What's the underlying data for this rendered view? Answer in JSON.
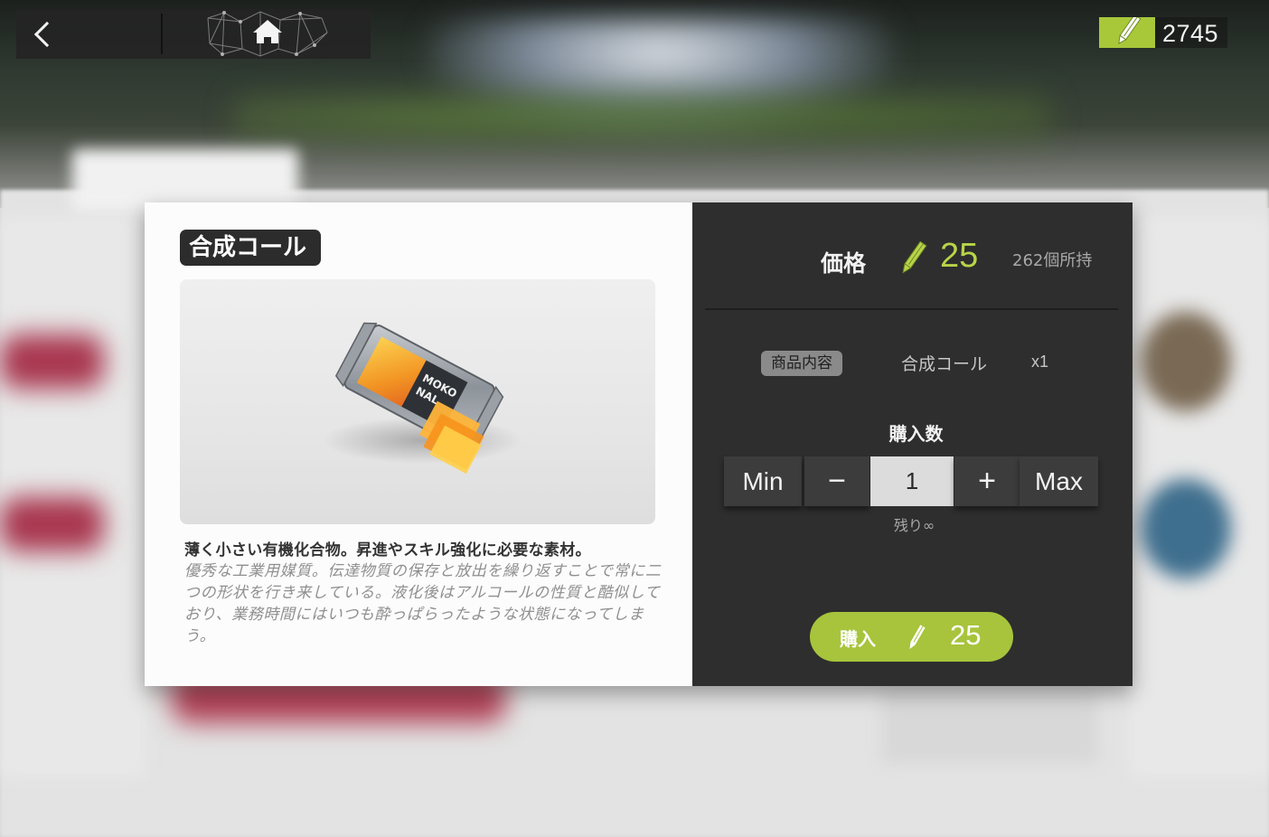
{
  "header": {
    "currency_value": "2745"
  },
  "item": {
    "name": "合成コール",
    "description": "薄く小さい有機化合物。昇進やスキル強化に必要な素材。",
    "flavor_text": "優秀な工業用媒質。伝達物質の保存と放出を繰り返すことで常に二つの形状を行き来している。液化後はアルコールの性質と酷似しており、業務時間にはいつも酔っぱらったような状態になってしまう。"
  },
  "purchase": {
    "price_label": "価格",
    "price": "25",
    "owned": "262個所持",
    "contents_badge": "商品内容",
    "contents_name": "合成コール",
    "contents_qty": "x1",
    "quantity_label": "購入数",
    "min_label": "Min",
    "minus_label": "−",
    "quantity": "1",
    "plus_label": "+",
    "max_label": "Max",
    "remaining": "残り∞",
    "buy_label": "購入",
    "buy_price": "25"
  },
  "colors": {
    "accent_green": "#a7c43c",
    "price_green": "#b8d44a",
    "panel_dark": "#2e2e2e"
  },
  "icons": {
    "currency": "pen-currency-icon",
    "back": "chevron-left-icon",
    "home": "home-icon"
  }
}
